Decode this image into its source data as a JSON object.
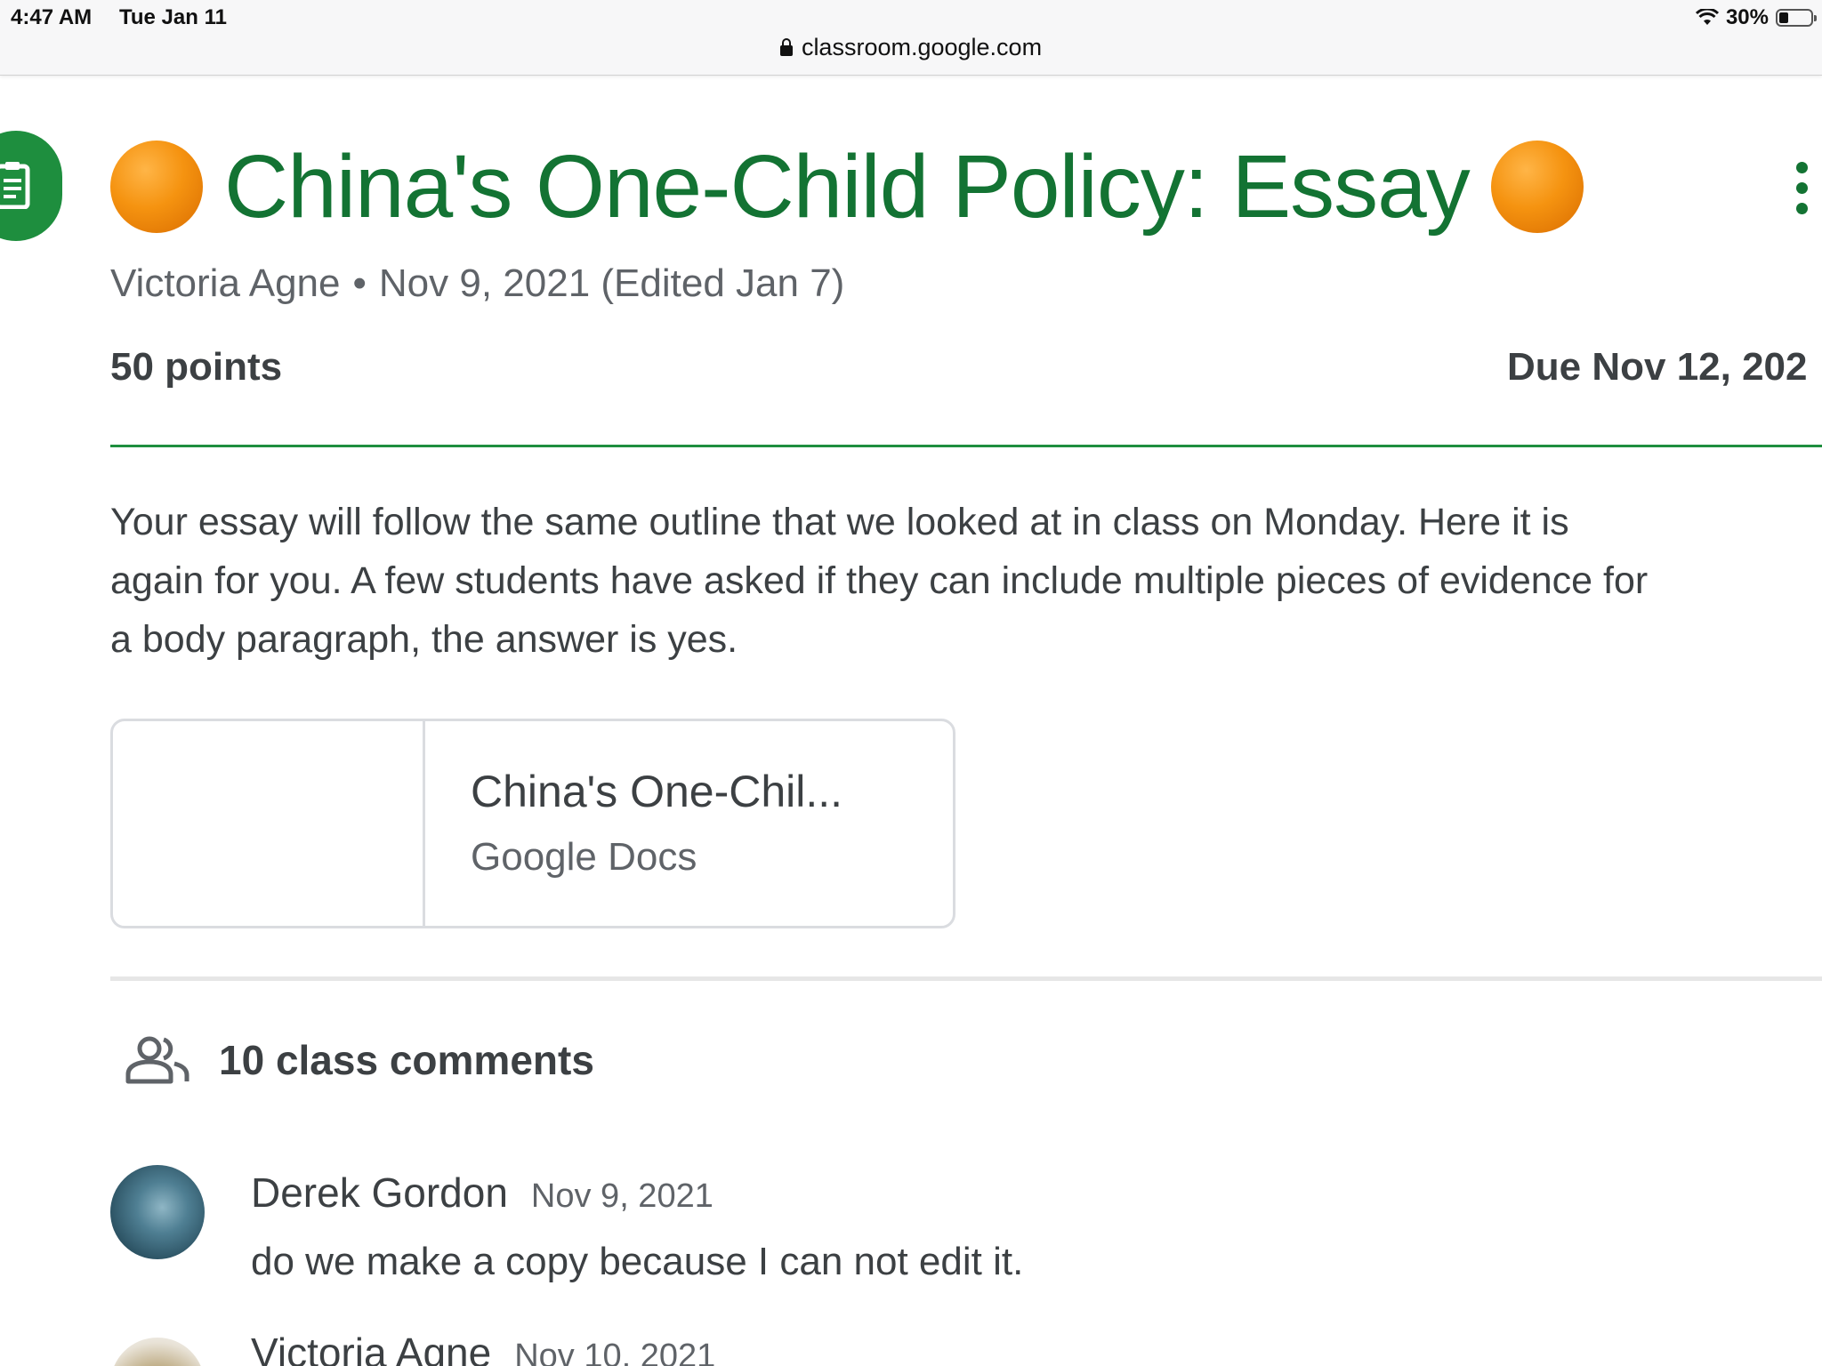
{
  "status_bar": {
    "time": "4:47 AM",
    "date": "Tue Jan 11",
    "battery_percent": "30%",
    "battery_level": 0.3
  },
  "browser": {
    "url": "classroom.google.com"
  },
  "assignment": {
    "title": "China's One-Child Policy: Essay",
    "author": "Victoria Agne",
    "separator": "•",
    "posted": "Nov 9, 2021 (Edited Jan 7)",
    "points": "50 points",
    "due": "Due Nov 12, 202",
    "description_lines": [
      "Your essay will follow the same outline that we looked at in class on Monday.  Here it is",
      "again for you.  A few students have asked if they can include multiple pieces of evidence for",
      "a body paragraph, the answer is yes."
    ],
    "attachment": {
      "title": "China's One-Chil...",
      "type": "Google Docs"
    }
  },
  "comments": {
    "count_label": "10 class comments",
    "items": [
      {
        "author": "Derek Gordon",
        "date": "Nov 9, 2021",
        "text": "do we make a copy because I can not edit it."
      },
      {
        "author": "Victoria Agne",
        "date": "Nov 10, 2021",
        "text": ""
      }
    ]
  },
  "colors": {
    "brand_green": "#137333",
    "accent_orange": "#f59310",
    "text_primary": "#3c4043",
    "text_secondary": "#5f6368"
  },
  "icons": {
    "header": "assignment-icon",
    "emoji": "orange-circle",
    "menu": "more-vert-icon",
    "comments": "people-icon",
    "url": "lock-icon"
  }
}
